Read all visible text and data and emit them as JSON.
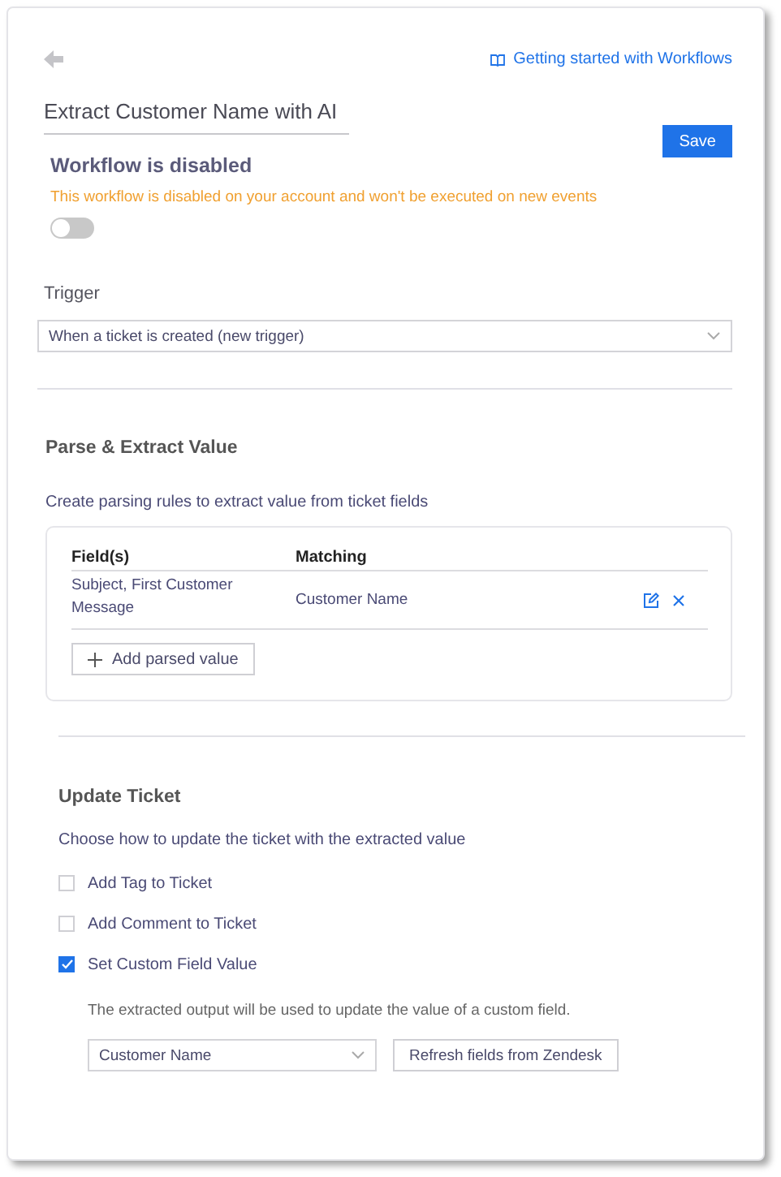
{
  "header": {
    "help_link": "Getting started with Workflows",
    "title_value": "Extract Customer Name with AI",
    "save_button": "Save"
  },
  "status": {
    "title": "Workflow is disabled",
    "message": "This workflow is disabled on your account and won't be executed on new events",
    "enabled": false
  },
  "trigger": {
    "label": "Trigger",
    "value": "When a ticket is created (new trigger)"
  },
  "parse": {
    "title": "Parse & Extract Value",
    "description": "Create parsing rules to extract value from ticket fields",
    "columns": [
      "Field(s)",
      "Matching"
    ],
    "rows": [
      {
        "fields": "Subject, First Customer Message",
        "matching": "Customer Name"
      }
    ],
    "add_button": "Add parsed value"
  },
  "update": {
    "title": "Update Ticket",
    "description": "Choose how to update the ticket with the extracted value",
    "options": [
      {
        "label": "Add Tag to Ticket",
        "checked": false
      },
      {
        "label": "Add Comment to Ticket",
        "checked": false
      },
      {
        "label": "Set Custom Field Value",
        "checked": true
      }
    ],
    "note": "The extracted output will be used to update the value of a custom field.",
    "field_value": "Customer Name",
    "refresh_button": "Refresh fields from Zendesk"
  }
}
